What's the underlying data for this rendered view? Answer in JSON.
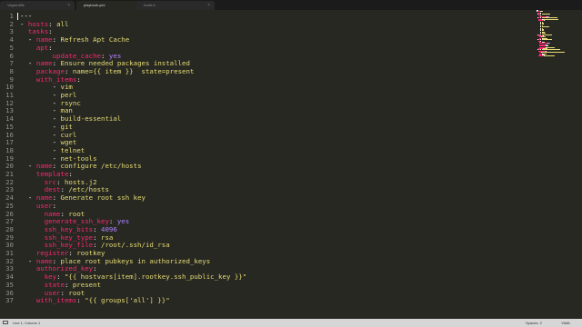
{
  "tabs": [
    {
      "label": "Vagrantfile",
      "active": false
    },
    {
      "label": "playbook.yml",
      "active": true
    },
    {
      "label": "hosts.ll",
      "active": false
    }
  ],
  "tab_close_glyph": "×",
  "colors": {
    "background": "#272822",
    "key": "#f92672",
    "string": "#e6db74",
    "boolean": "#ae81ff",
    "plain": "#f8f8f2",
    "line_number": "#8f908a",
    "statusbar": "#d6d6d6"
  },
  "editor": {
    "lines": [
      {
        "n": "1",
        "indent": "",
        "tokens": [
          {
            "t": "---",
            "c": "plain"
          }
        ]
      },
      {
        "n": "2",
        "indent": "",
        "tokens": [
          {
            "t": "- ",
            "c": "plain"
          },
          {
            "t": "hosts",
            "c": "key"
          },
          {
            "t": ": ",
            "c": "plain"
          },
          {
            "t": "all",
            "c": "val"
          }
        ]
      },
      {
        "n": "3",
        "indent": "  ",
        "tokens": [
          {
            "t": "tasks",
            "c": "key"
          },
          {
            "t": ":",
            "c": "plain"
          }
        ]
      },
      {
        "n": "4",
        "indent": "  ",
        "tokens": [
          {
            "t": "- ",
            "c": "plain"
          },
          {
            "t": "name",
            "c": "key"
          },
          {
            "t": ": ",
            "c": "plain"
          },
          {
            "t": "Refresh Apt Cache",
            "c": "val"
          }
        ]
      },
      {
        "n": "5",
        "indent": "    ",
        "tokens": [
          {
            "t": "apt",
            "c": "key"
          },
          {
            "t": ":",
            "c": "plain"
          }
        ]
      },
      {
        "n": "6",
        "indent": "        ",
        "tokens": [
          {
            "t": "update_cache",
            "c": "key"
          },
          {
            "t": ": ",
            "c": "plain"
          },
          {
            "t": "yes",
            "c": "bool"
          }
        ]
      },
      {
        "n": "7",
        "indent": "  ",
        "tokens": [
          {
            "t": "- ",
            "c": "plain"
          },
          {
            "t": "name",
            "c": "key"
          },
          {
            "t": ": ",
            "c": "plain"
          },
          {
            "t": "Ensure needed packages installed",
            "c": "val"
          }
        ]
      },
      {
        "n": "8",
        "indent": "    ",
        "tokens": [
          {
            "t": "package",
            "c": "key"
          },
          {
            "t": ": ",
            "c": "plain"
          },
          {
            "t": "name={{ item }}  state=present",
            "c": "val"
          }
        ]
      },
      {
        "n": "9",
        "indent": "    ",
        "tokens": [
          {
            "t": "with_items",
            "c": "key"
          },
          {
            "t": ":",
            "c": "plain"
          }
        ]
      },
      {
        "n": "10",
        "indent": "        ",
        "tokens": [
          {
            "t": "- ",
            "c": "plain"
          },
          {
            "t": "vim",
            "c": "val"
          }
        ]
      },
      {
        "n": "11",
        "indent": "        ",
        "tokens": [
          {
            "t": "- ",
            "c": "plain"
          },
          {
            "t": "perl",
            "c": "val"
          }
        ]
      },
      {
        "n": "12",
        "indent": "        ",
        "tokens": [
          {
            "t": "- ",
            "c": "plain"
          },
          {
            "t": "rsync",
            "c": "val"
          }
        ]
      },
      {
        "n": "13",
        "indent": "        ",
        "tokens": [
          {
            "t": "- ",
            "c": "plain"
          },
          {
            "t": "man",
            "c": "val"
          }
        ]
      },
      {
        "n": "14",
        "indent": "        ",
        "tokens": [
          {
            "t": "- ",
            "c": "plain"
          },
          {
            "t": "build-essential",
            "c": "val"
          }
        ]
      },
      {
        "n": "15",
        "indent": "        ",
        "tokens": [
          {
            "t": "- ",
            "c": "plain"
          },
          {
            "t": "git",
            "c": "val"
          }
        ]
      },
      {
        "n": "16",
        "indent": "        ",
        "tokens": [
          {
            "t": "- ",
            "c": "plain"
          },
          {
            "t": "curl",
            "c": "val"
          }
        ]
      },
      {
        "n": "17",
        "indent": "        ",
        "tokens": [
          {
            "t": "- ",
            "c": "plain"
          },
          {
            "t": "wget",
            "c": "val"
          }
        ]
      },
      {
        "n": "18",
        "indent": "        ",
        "tokens": [
          {
            "t": "- ",
            "c": "plain"
          },
          {
            "t": "telnet",
            "c": "val"
          }
        ]
      },
      {
        "n": "19",
        "indent": "        ",
        "tokens": [
          {
            "t": "- ",
            "c": "plain"
          },
          {
            "t": "net-tools",
            "c": "val"
          }
        ]
      },
      {
        "n": "20",
        "indent": "  ",
        "tokens": [
          {
            "t": "- ",
            "c": "plain"
          },
          {
            "t": "name",
            "c": "key"
          },
          {
            "t": ": ",
            "c": "plain"
          },
          {
            "t": "configure /etc/hosts",
            "c": "val"
          }
        ]
      },
      {
        "n": "21",
        "indent": "    ",
        "tokens": [
          {
            "t": "template",
            "c": "key"
          },
          {
            "t": ":",
            "c": "plain"
          }
        ]
      },
      {
        "n": "22",
        "indent": "      ",
        "tokens": [
          {
            "t": "src",
            "c": "key"
          },
          {
            "t": ": ",
            "c": "plain"
          },
          {
            "t": "hosts.j2",
            "c": "val"
          }
        ]
      },
      {
        "n": "23",
        "indent": "      ",
        "tokens": [
          {
            "t": "dest",
            "c": "key"
          },
          {
            "t": ": ",
            "c": "plain"
          },
          {
            "t": "/etc/hosts",
            "c": "val"
          }
        ]
      },
      {
        "n": "24",
        "indent": "  ",
        "tokens": [
          {
            "t": "- ",
            "c": "plain"
          },
          {
            "t": "name",
            "c": "key"
          },
          {
            "t": ": ",
            "c": "plain"
          },
          {
            "t": "Generate root ssh key",
            "c": "val"
          }
        ]
      },
      {
        "n": "25",
        "indent": "    ",
        "tokens": [
          {
            "t": "user",
            "c": "key"
          },
          {
            "t": ":",
            "c": "plain"
          }
        ]
      },
      {
        "n": "26",
        "indent": "      ",
        "tokens": [
          {
            "t": "name",
            "c": "key"
          },
          {
            "t": ": ",
            "c": "plain"
          },
          {
            "t": "root",
            "c": "val"
          }
        ]
      },
      {
        "n": "27",
        "indent": "      ",
        "tokens": [
          {
            "t": "generate_ssh_key",
            "c": "key"
          },
          {
            "t": ": ",
            "c": "plain"
          },
          {
            "t": "yes",
            "c": "bool"
          }
        ]
      },
      {
        "n": "28",
        "indent": "      ",
        "tokens": [
          {
            "t": "ssh_key_bits",
            "c": "key"
          },
          {
            "t": ": ",
            "c": "plain"
          },
          {
            "t": "4096",
            "c": "bool"
          }
        ]
      },
      {
        "n": "29",
        "indent": "      ",
        "tokens": [
          {
            "t": "ssh_key_type",
            "c": "key"
          },
          {
            "t": ": ",
            "c": "plain"
          },
          {
            "t": "rsa",
            "c": "val"
          }
        ]
      },
      {
        "n": "30",
        "indent": "      ",
        "tokens": [
          {
            "t": "ssh_key_file",
            "c": "key"
          },
          {
            "t": ": ",
            "c": "plain"
          },
          {
            "t": "/root/.ssh/id_rsa",
            "c": "val"
          }
        ]
      },
      {
        "n": "31",
        "indent": "    ",
        "tokens": [
          {
            "t": "register",
            "c": "key"
          },
          {
            "t": ": ",
            "c": "plain"
          },
          {
            "t": "rootkey",
            "c": "val"
          }
        ]
      },
      {
        "n": "32",
        "indent": "  ",
        "tokens": [
          {
            "t": "- ",
            "c": "plain"
          },
          {
            "t": "name",
            "c": "key"
          },
          {
            "t": ": ",
            "c": "plain"
          },
          {
            "t": "place root pubkeys in authorized_keys",
            "c": "val"
          }
        ]
      },
      {
        "n": "33",
        "indent": "    ",
        "tokens": [
          {
            "t": "authorized_key",
            "c": "key"
          },
          {
            "t": ":",
            "c": "plain"
          }
        ]
      },
      {
        "n": "34",
        "indent": "      ",
        "tokens": [
          {
            "t": "key",
            "c": "key"
          },
          {
            "t": ": ",
            "c": "plain"
          },
          {
            "t": "\"{{ hostvars[item].rootkey.ssh_public_key }}\"",
            "c": "val"
          }
        ]
      },
      {
        "n": "35",
        "indent": "      ",
        "tokens": [
          {
            "t": "state",
            "c": "key"
          },
          {
            "t": ": ",
            "c": "plain"
          },
          {
            "t": "present",
            "c": "val"
          }
        ]
      },
      {
        "n": "36",
        "indent": "      ",
        "tokens": [
          {
            "t": "user",
            "c": "key"
          },
          {
            "t": ": ",
            "c": "plain"
          },
          {
            "t": "root",
            "c": "val"
          }
        ]
      },
      {
        "n": "37",
        "indent": "    ",
        "tokens": [
          {
            "t": "with_items",
            "c": "key"
          },
          {
            "t": ": ",
            "c": "plain"
          },
          {
            "t": "\"{{ groups['all'] }}\"",
            "c": "val"
          }
        ]
      }
    ]
  },
  "statusbar": {
    "position": "Line 1, Column 1",
    "spaces": "Spaces: 2",
    "syntax": "YAML"
  }
}
